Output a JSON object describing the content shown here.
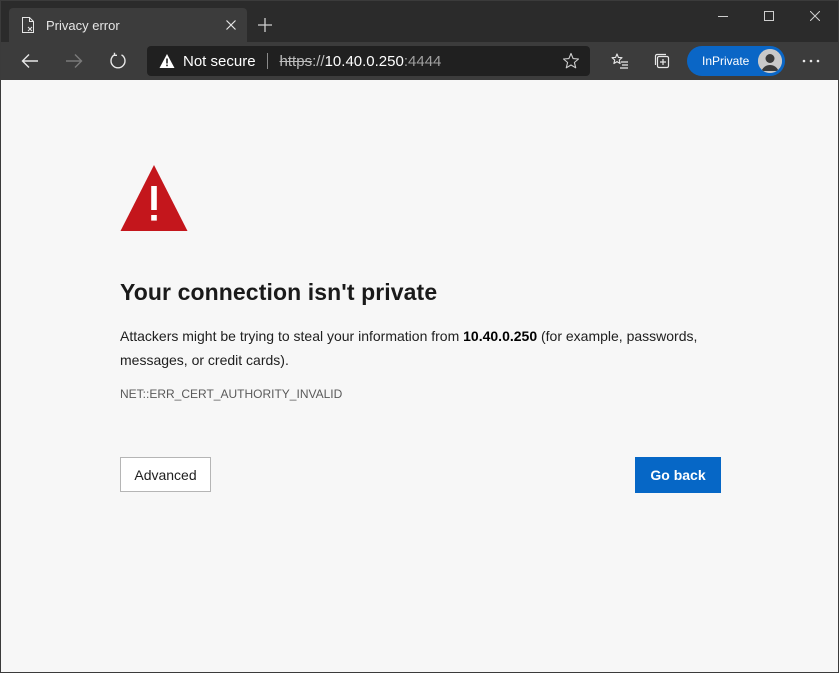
{
  "tab": {
    "title": "Privacy error",
    "icon": "document-error-icon"
  },
  "toolbar": {
    "security_label": "Not secure",
    "url": {
      "scheme": "https",
      "separator": "://",
      "host": "10.40.0.250",
      "port": ":4444"
    },
    "profile_label": "InPrivate"
  },
  "page": {
    "heading": "Your connection isn't private",
    "description_before": "Attackers might be trying to steal your information from ",
    "description_host": "10.40.0.250",
    "description_after": " (for example, passwords, messages, or credit cards).",
    "error_code": "NET::ERR_CERT_AUTHORITY_INVALID",
    "advanced_label": "Advanced",
    "go_back_label": "Go back"
  },
  "colors": {
    "warning_red": "#c4161c",
    "primary_blue": "#0667c6",
    "inprivate_blue": "#0a66c6"
  }
}
